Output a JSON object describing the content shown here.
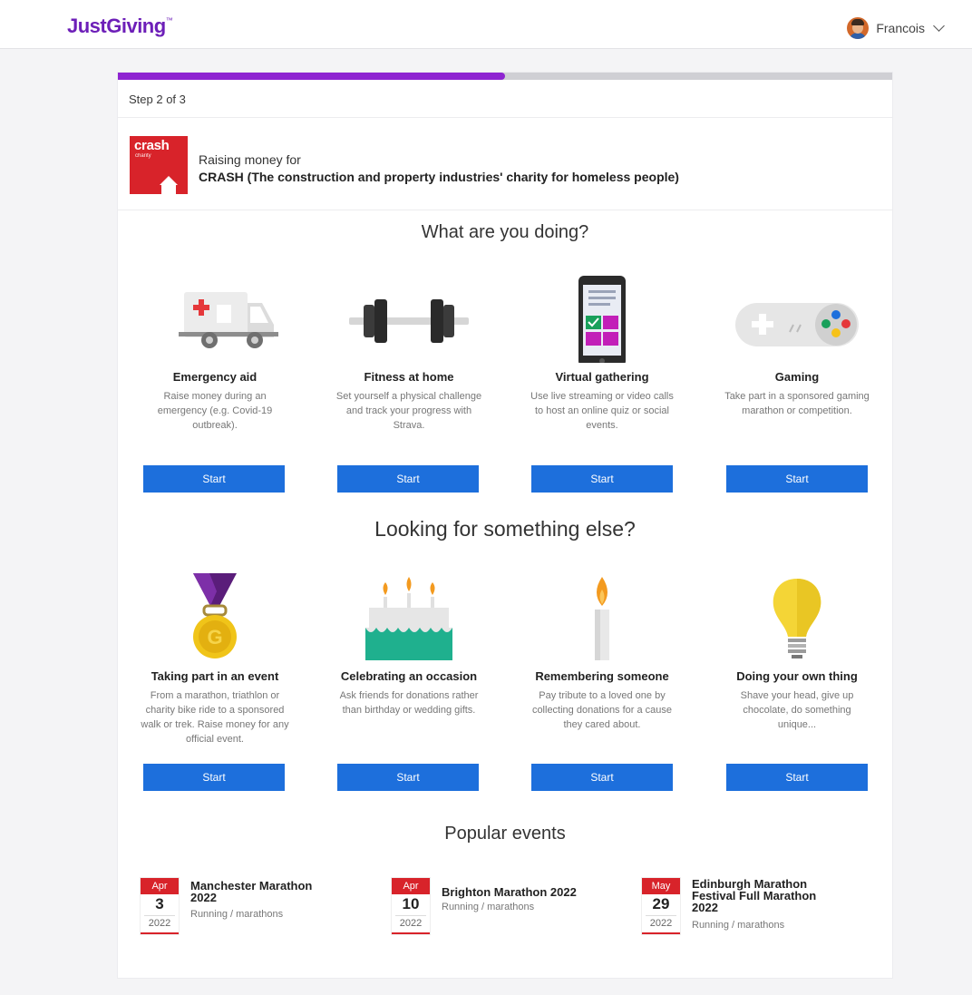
{
  "header": {
    "logo": "JustGiving",
    "logo_tm": "™",
    "user_name": "Francois"
  },
  "progress": {
    "step_label": "Step 2 of 3",
    "fraction": 0.5
  },
  "charity": {
    "logo_word": "crash",
    "logo_sub": "charity",
    "raising_label": "Raising money for",
    "name": "CRASH (The construction and property industries' charity for homeless people)"
  },
  "doing": {
    "heading": "What are you doing?",
    "tiles": [
      {
        "title": "Emergency aid",
        "desc": "Raise money during an emergency (e.g. Covid-19 outbreak).",
        "button": "Start",
        "icon": "ambulance-icon"
      },
      {
        "title": "Fitness at home",
        "desc": "Set yourself a physical challenge and track your progress with Strava.",
        "button": "Start",
        "icon": "dumbbell-icon"
      },
      {
        "title": "Virtual gathering",
        "desc": "Use live streaming or video calls to host an online quiz or social events.",
        "button": "Start",
        "icon": "smartphone-icon"
      },
      {
        "title": "Gaming",
        "desc": "Take part in a sponsored gaming marathon or competition.",
        "button": "Start",
        "icon": "gamepad-icon"
      }
    ]
  },
  "else": {
    "heading": "Looking for something else?",
    "tiles": [
      {
        "title": "Taking part in an event",
        "desc": "From a marathon, triathlon or charity bike ride to a sponsored walk or trek. Raise money for any official event.",
        "button": "Start",
        "icon": "medal-icon",
        "medal_letter": "G"
      },
      {
        "title": "Celebrating an occasion",
        "desc": "Ask friends for donations rather than birthday or wedding gifts.",
        "button": "Start",
        "icon": "cake-icon"
      },
      {
        "title": "Remembering someone",
        "desc": "Pay tribute to a loved one by collecting donations for a cause they cared about.",
        "button": "Start",
        "icon": "candle-icon"
      },
      {
        "title": "Doing your own thing",
        "desc": "Shave your head, give up chocolate, do something unique...",
        "button": "Start",
        "icon": "lightbulb-icon"
      }
    ]
  },
  "popular": {
    "heading": "Popular events",
    "events": [
      {
        "month": "Apr",
        "day": "3",
        "year": "2022",
        "name": "Manchester Marathon 2022",
        "category": "Running / marathons"
      },
      {
        "month": "Apr",
        "day": "10",
        "year": "2022",
        "name": "Brighton Marathon 2022",
        "category": "Running / marathons"
      },
      {
        "month": "May",
        "day": "29",
        "year": "2022",
        "name": "Edinburgh Marathon Festival Full Marathon 2022",
        "category": "Running / marathons"
      }
    ]
  },
  "colors": {
    "brand": "#6d1fb8",
    "progress": "#8e24d1",
    "button": "#1d6fdc",
    "crash_red": "#d8232a"
  }
}
